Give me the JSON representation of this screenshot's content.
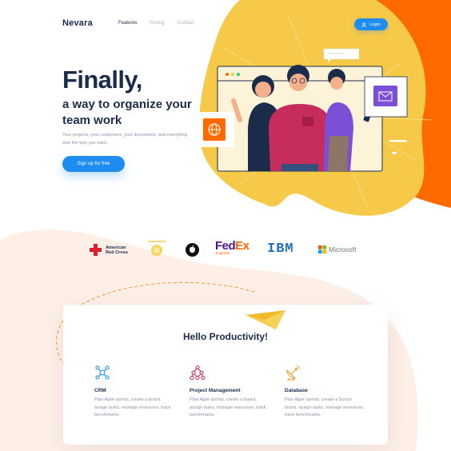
{
  "header": {
    "brand": "Nevara",
    "nav": [
      "Features",
      "Pricing",
      "Contact"
    ],
    "login_label": "Login"
  },
  "hero": {
    "headline": "Finally,",
    "subheadline": "a way to organize your team work",
    "description": "Your projects, your customers, your documents, and everything else the way you want.",
    "cta_label": "Sign up for free"
  },
  "brands": {
    "red_cross": "American Red Cross",
    "fedex_a": "Fed",
    "fedex_b": "Ex",
    "fedex_sub": "Express",
    "ibm": "IBM",
    "microsoft": "Microsoft"
  },
  "features_section": {
    "title": "Hello Productivity!",
    "items": [
      {
        "title": "CRM",
        "desc": "Plan Agile sprints, create a board, assign tasks, manage resources, track benchmarks.",
        "icon": "team-network-icon"
      },
      {
        "title": "Project Management",
        "desc": "Plan Agile sprints, create a board, assign tasks, manage resources, track benchmarks.",
        "icon": "hierarchy-icon"
      },
      {
        "title": "Database",
        "desc": "Plan Agile sprints, create a Scrum board, assign tasks, manage resources, track benchmarks.",
        "icon": "satellite-dish-icon"
      }
    ]
  },
  "colors": {
    "primary": "#1e8cf0",
    "yellow": "#f7c948",
    "orange": "#ff6a00",
    "peach": "#fdeee4",
    "navy": "#1b2c4b",
    "muted": "#8a93a6"
  }
}
